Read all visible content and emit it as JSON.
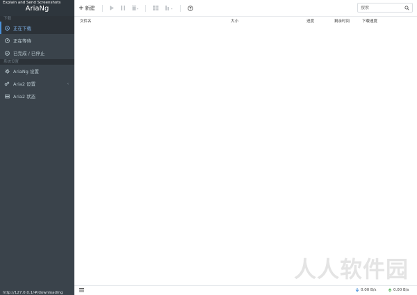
{
  "overlay_caption": "Explain and Send Screenshots",
  "app_title": "AriaNg",
  "sidebar": {
    "section_download": "下载",
    "download_items": [
      {
        "label": "正在下载"
      },
      {
        "label": "正在等待"
      },
      {
        "label": "已完成 / 已停止"
      }
    ],
    "section_settings": "系统设置",
    "settings_items": [
      {
        "label": "AriaNg 设置"
      },
      {
        "label": "Aria2 设置"
      },
      {
        "label": "Aria2 状态"
      }
    ],
    "rpc_url": "http://127.0.0.1/#/downloading"
  },
  "toolbar": {
    "new_label": "新建",
    "search_placeholder": "搜索"
  },
  "columns": [
    "文件名",
    "大小",
    "进度",
    "剩余时间",
    "下载速度"
  ],
  "footer": {
    "download_speed": "0.00 B/s",
    "upload_speed": "0.00 B/s"
  },
  "watermark": "人人软件园",
  "colors": {
    "sidebar_bg": "#3a434b",
    "active_accent": "#4a90d9"
  }
}
